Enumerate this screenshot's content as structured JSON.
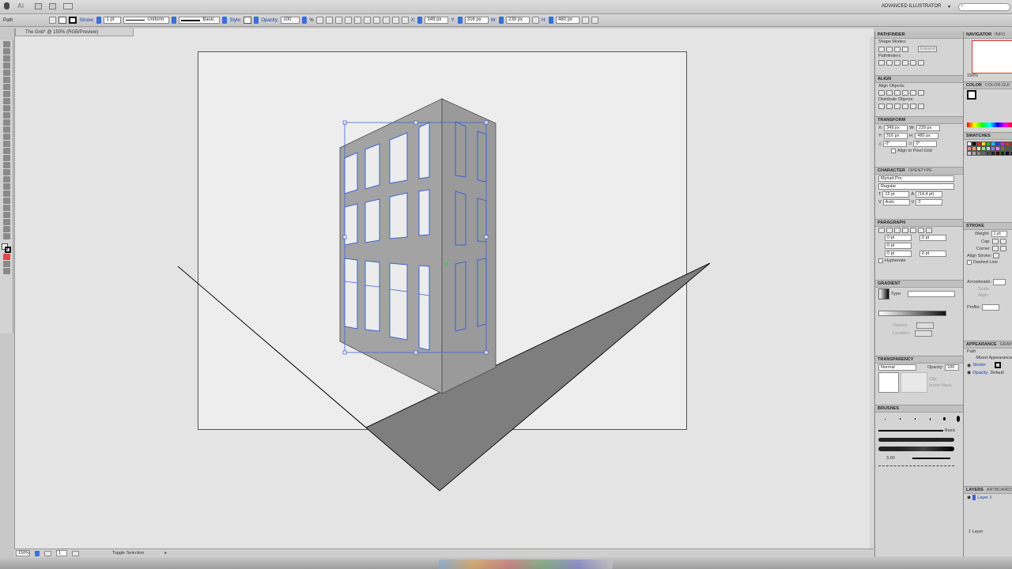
{
  "app": {
    "workspace": "ADVANCED ILLUSTRATOR",
    "search_placeholder": ""
  },
  "control_bar": {
    "selection": "Path",
    "stroke_label": "Stroke:",
    "stroke_weight": "1 pt",
    "stroke_profile": "Uniform",
    "brush": "Basic",
    "style_label": "Style:",
    "opacity_label": "Opacity:",
    "opacity": "100",
    "x_label": "X:",
    "x": "349 px",
    "y_label": "Y:",
    "y": "316 px",
    "w_label": "W:",
    "w": "239 px",
    "h_label": "H:",
    "h": "480 px"
  },
  "document": {
    "tab_title": "The Grid* @ 150% (RGB/Preview)",
    "zoom": "150%",
    "artboard": "1",
    "status": "Toggle Selection"
  },
  "panels": {
    "pathfinder": {
      "title": "PATHFINDER",
      "shape_modes": "Shape Modes:",
      "expand": "Expand",
      "pathfinders": "Pathfinders:"
    },
    "align": {
      "title": "ALIGN",
      "align_objects": "Align Objects:",
      "distribute_objects": "Distribute Objects:"
    },
    "transform": {
      "title": "TRANSFORM",
      "x": "349 px",
      "y": "316 px",
      "w": "239 px",
      "h": "480 px",
      "angle": "0°",
      "shear": "0°",
      "pixel_grid": "Align to Pixel Grid"
    },
    "character": {
      "title": "CHARACTER",
      "tab2": "OPENTYPE",
      "font": "Myriad Pro",
      "style": "Regular",
      "size": "12 pt",
      "leading": "(14.4 pt)",
      "kerning": "Auto",
      "tracking": "0"
    },
    "paragraph": {
      "title": "PARAGRAPH",
      "indent1": "0 pt",
      "indent2": "0 pt",
      "indent3": "0 pt",
      "space1": "0 pt",
      "space2": "0 pt",
      "hyphenate": "Hyphenate"
    },
    "gradient": {
      "title": "GRADIENT",
      "type_label": "Type:",
      "opacity_label": "Opacity:",
      "location_label": "Location:"
    },
    "transparency": {
      "title": "TRANSPARENCY",
      "mode": "Normal",
      "opacity_label": "Opacity:",
      "opacity": "100",
      "clip": "Clip",
      "invert": "Invert Mask"
    },
    "brushes": {
      "title": "BRUSHES",
      "basic": "Basic",
      "size": "3.00"
    },
    "navigator": {
      "title": "NAVIGATOR",
      "tab2": "INFO",
      "zoom": "150%"
    },
    "color": {
      "title": "COLOR",
      "tab2": "COLOR GUI"
    },
    "swatches": {
      "title": "SWATCHES"
    },
    "stroke": {
      "title": "STROKE",
      "weight_label": "Weight:",
      "weight": "1 pt",
      "cap_label": "Cap:",
      "corner_label": "Corner:",
      "align_label": "Align Stroke:",
      "dashed": "Dashed Line",
      "arrowheads": "Arrowheads:",
      "scale": "Scale:",
      "align": "Align:",
      "profile": "Profile:"
    },
    "appearance": {
      "title": "APPEARANCE",
      "tab2": "GRAPHIC",
      "path": "Path",
      "mixed": "Mixed Appearance",
      "stroke_label": "Stroke:",
      "opacity_label": "Opacity:",
      "opacity_value": "Default"
    },
    "layers": {
      "title": "LAYERS",
      "tab2": "ARTBOARDS",
      "layer1": "Layer 1",
      "count": "1 Layer"
    }
  },
  "colors": {
    "selection": "#3f63d6",
    "shape_fill": "#7e7e7e",
    "building_fill": "#a3a3a3",
    "window_fill": "#ececec"
  }
}
